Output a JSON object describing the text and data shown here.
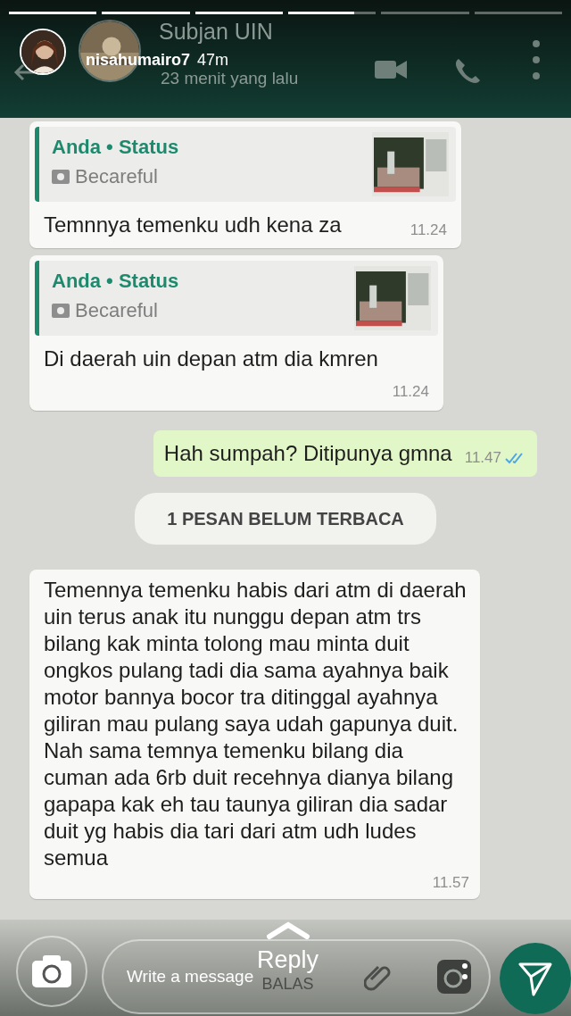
{
  "story": {
    "progress": [
      {
        "kind": "viewed"
      },
      {
        "kind": "viewed"
      },
      {
        "kind": "viewed"
      },
      {
        "kind": "current",
        "level": 0.75
      },
      {
        "kind": "upcoming"
      },
      {
        "kind": "upcoming"
      }
    ],
    "username": "nisahumairo7",
    "time": "47m"
  },
  "chat_header": {
    "title": "Subjan UIN",
    "subtitle": "23 menit yang lalu"
  },
  "messages": [
    {
      "kind": "reply",
      "quote_author": "Anda • Status",
      "quote_text": "Becareful",
      "text": "Temnnya temenku udh kena za",
      "time": "11.24"
    },
    {
      "kind": "reply",
      "quote_author": "Anda • Status",
      "quote_text": "Becareful",
      "text": "Di daerah uin depan atm dia kmren",
      "time": "11.24"
    },
    {
      "kind": "outgoing",
      "text": "Hah sumpah? Ditipunya gmna",
      "time": "11.47",
      "read": true
    },
    {
      "kind": "banner",
      "text": "1 PESAN BELUM TERBACA"
    },
    {
      "kind": "incoming",
      "text": "Temennya temenku habis dari atm di daerah uin terus anak itu nunggu depan atm trs bilang kak minta tolong mau minta duit ongkos pulang tadi dia sama ayahnya baik motor bannya bocor tra ditinggal ayahnya giliran mau pulang saya udah gapunya duit. Nah sama temnya temenku bilang dia cuman ada 6rb duit recehnya dianya bilang gapapa kak eh tau taunya giliran dia sadar duit yg habis dia tari dari atm udh ludes semua",
      "time": "11.57"
    }
  ],
  "reply_bar": {
    "placeholder": "Write a message",
    "label": "Reply",
    "sublabel": "BALAS"
  }
}
